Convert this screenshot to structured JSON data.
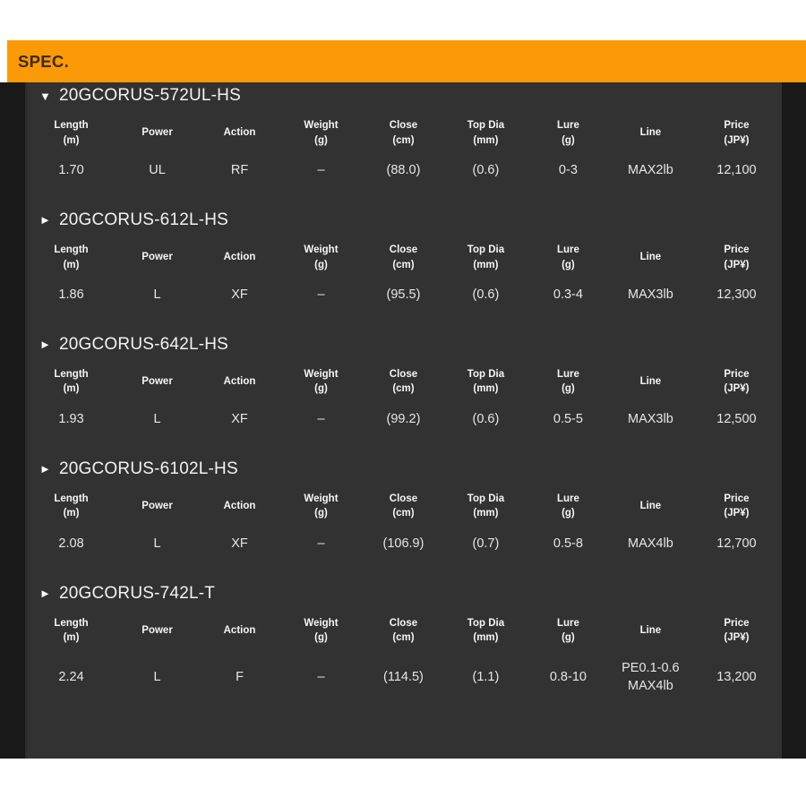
{
  "header": {
    "title": "SPEC.",
    "background_color": "#fb9a07",
    "text_color": "#3d2a06"
  },
  "theme": {
    "body_background": "#323232",
    "outer_background": "#191919",
    "text_color": "#e6e6e6"
  },
  "columns": [
    {
      "label": "Length",
      "unit": "(m)"
    },
    {
      "label": "Power",
      "unit": ""
    },
    {
      "label": "Action",
      "unit": ""
    },
    {
      "label": "Weight",
      "unit": "(g)"
    },
    {
      "label": "Close",
      "unit": "(cm)"
    },
    {
      "label": "Top Dia",
      "unit": "(mm)"
    },
    {
      "label": "Lure",
      "unit": "(g)"
    },
    {
      "label": "Line",
      "unit": ""
    },
    {
      "label": "Price",
      "unit": "(JP¥)"
    }
  ],
  "groups": [
    {
      "name": "20GCORUS-572UL-HS",
      "expanded": true,
      "arrow": "▼",
      "values": {
        "length": "1.70",
        "power": "UL",
        "action": "RF",
        "weight": "–",
        "close": "(88.0)",
        "top_dia": "(0.6)",
        "lure": "0-3",
        "line": "MAX2lb",
        "price": "12,100"
      }
    },
    {
      "name": "20GCORUS-612L-HS",
      "expanded": false,
      "arrow": "►",
      "values": {
        "length": "1.86",
        "power": "L",
        "action": "XF",
        "weight": "–",
        "close": "(95.5)",
        "top_dia": "(0.6)",
        "lure": "0.3-4",
        "line": "MAX3lb",
        "price": "12,300"
      }
    },
    {
      "name": "20GCORUS-642L-HS",
      "expanded": false,
      "arrow": "►",
      "values": {
        "length": "1.93",
        "power": "L",
        "action": "XF",
        "weight": "–",
        "close": "(99.2)",
        "top_dia": "(0.6)",
        "lure": "0.5-5",
        "line": "MAX3lb",
        "price": "12,500"
      }
    },
    {
      "name": "20GCORUS-6102L-HS",
      "expanded": false,
      "arrow": "►",
      "values": {
        "length": "2.08",
        "power": "L",
        "action": "XF",
        "weight": "–",
        "close": "(106.9)",
        "top_dia": "(0.7)",
        "lure": "0.5-8",
        "line": "MAX4lb",
        "price": "12,700"
      }
    },
    {
      "name": "20GCORUS-742L-T",
      "expanded": false,
      "arrow": "►",
      "values": {
        "length": "2.24",
        "power": "L",
        "action": "F",
        "weight": "–",
        "close": "(114.5)",
        "top_dia": "(1.1)",
        "lure": "0.8-10",
        "line": "PE0.1-0.6\nMAX4lb",
        "price": "13,200"
      }
    }
  ]
}
